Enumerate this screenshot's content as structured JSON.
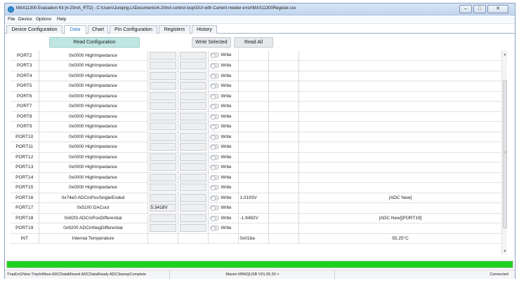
{
  "window": {
    "title": "MAX11300 Evaluation Kit [4-20mA_RTD] - C:\\Users\\Junqing.Li\\Documents\\4-20mA control loop\\GUI with Current meeter error\\MAX11300Register.csv",
    "controls": {
      "minimize": "–",
      "maximize": "□",
      "close": "✕"
    }
  },
  "menu": {
    "items": [
      "File",
      "Device",
      "Options",
      "Help"
    ]
  },
  "tabs": [
    {
      "label": "Device Configuration",
      "active": false
    },
    {
      "label": "Data",
      "active": true
    },
    {
      "label": "Chart",
      "active": false
    },
    {
      "label": "Pin Configuration",
      "active": false
    },
    {
      "label": "Registers",
      "active": false
    },
    {
      "label": "History",
      "active": false
    }
  ],
  "toolbar": {
    "read_configuration": "Read Configuration",
    "write_selected": "Write Selected",
    "read_all": "Read All"
  },
  "write_label": "Write",
  "rows": [
    {
      "name": "PORT2",
      "config": "0x0000 HighImpedance",
      "input1": "",
      "raw": "",
      "comment": "",
      "write": true
    },
    {
      "name": "PORT3",
      "config": "0x0000 HighImpedance",
      "input1": "",
      "raw": "",
      "comment": "",
      "write": true
    },
    {
      "name": "PORT4",
      "config": "0x0000 HighImpedance",
      "input1": "",
      "raw": "",
      "comment": "",
      "write": true
    },
    {
      "name": "PORT5",
      "config": "0x0000 HighImpedance",
      "input1": "",
      "raw": "",
      "comment": "",
      "write": true
    },
    {
      "name": "PORT6",
      "config": "0x0000 HighImpedance",
      "input1": "",
      "raw": "",
      "comment": "",
      "write": true
    },
    {
      "name": "PORT7",
      "config": "0x0000 HighImpedance",
      "input1": "",
      "raw": "",
      "comment": "",
      "write": true
    },
    {
      "name": "PORT8",
      "config": "0x0000 HighImpedance",
      "input1": "",
      "raw": "",
      "comment": "",
      "write": true
    },
    {
      "name": "PORT9",
      "config": "0x0000 HighImpedance",
      "input1": "",
      "raw": "",
      "comment": "",
      "write": true
    },
    {
      "name": "PORT10",
      "config": "0x0000 HighImpedance",
      "input1": "",
      "raw": "",
      "comment": "",
      "write": true
    },
    {
      "name": "PORT11",
      "config": "0x0000 HighImpedance",
      "input1": "",
      "raw": "",
      "comment": "",
      "write": true
    },
    {
      "name": "PORT12",
      "config": "0x0000 HighImpedance",
      "input1": "",
      "raw": "",
      "comment": "",
      "write": true
    },
    {
      "name": "PORT13",
      "config": "0x0000 HighImpedance",
      "input1": "",
      "raw": "",
      "comment": "",
      "write": true
    },
    {
      "name": "PORT14",
      "config": "0x0000 HighImpedance",
      "input1": "",
      "raw": "",
      "comment": "",
      "write": true
    },
    {
      "name": "PORT15",
      "config": "0x0000 HighImpedance",
      "input1": "",
      "raw": "",
      "comment": "",
      "write": true
    },
    {
      "name": "PORT16",
      "config": "0x74e0 ADCinPosSingleEnded",
      "input1": "",
      "raw": "1.0193V",
      "comment": "[ADC New]",
      "write": true
    },
    {
      "name": "PORT17",
      "config": "0x5100 DACout",
      "input1": "5.3418V",
      "raw": "",
      "comment": "",
      "write": true
    },
    {
      "name": "PORT18",
      "config": "0x82f3 ADCinPosDifferential",
      "input1": "",
      "raw": "-1.9482V",
      "comment": "[ADC New][PORT19]",
      "write": true
    },
    {
      "name": "PORT19",
      "config": "0x9200 ADCinNegDifferential",
      "input1": "",
      "raw": "",
      "comment": "",
      "write": true
    },
    {
      "name": "INT",
      "config": "Internal Temperature",
      "input1": "",
      "raw": "0x01ba",
      "comment": "55.25°C",
      "write": false
    }
  ],
  "scrollbar": {
    "up": "▲",
    "down": "▼",
    "grip": "≡"
  },
  "progress": {
    "percent": 100,
    "color": "#1fd11f"
  },
  "status": {
    "events": "TmpEvt1New TmpIntNew ADCDataMissed ADCDataReady ADCSweepComplete",
    "device": "Maxim MINIQUSB V01.05.50 >",
    "connection": "Connected"
  },
  "colors": {
    "accent_tab": "#2a7fd0",
    "read_config_button": "#bfe6e2",
    "titlebar": "#c2d6ee"
  }
}
